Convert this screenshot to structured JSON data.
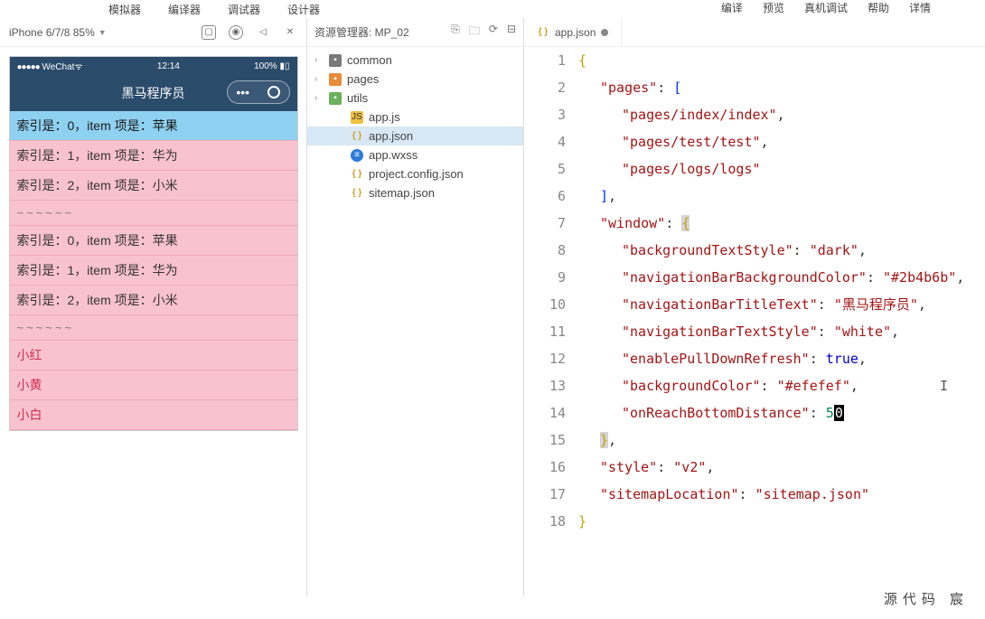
{
  "top_menu_left": [
    "模拟器",
    "编译器",
    "调试器",
    "设计器"
  ],
  "top_menu_right": [
    "编译",
    "预览",
    "真机调试",
    "帮助",
    "详情"
  ],
  "simulator": {
    "device_label": "iPhone 6/7/8 85%",
    "status": {
      "carrier": "WeChat",
      "dots": "●●●●●",
      "time": "12:14",
      "battery": "100%"
    },
    "nav_title": "黑马程序员",
    "rows": [
      {
        "type": "blue",
        "text": "索引是：0，item 项是：苹果"
      },
      {
        "type": "pink",
        "text": "索引是：1，item 项是：华为"
      },
      {
        "type": "pink",
        "text": "索引是：2，item 项是：小米"
      },
      {
        "type": "tilde",
        "text": "~~~~~~"
      },
      {
        "type": "pink",
        "text": "索引是：0，item 项是：苹果"
      },
      {
        "type": "pink",
        "text": "索引是：1，item 项是：华为"
      },
      {
        "type": "pink",
        "text": "索引是：2，item 项是：小米"
      },
      {
        "type": "tilde",
        "text": "~~~~~~"
      },
      {
        "type": "name",
        "text": "小红"
      },
      {
        "type": "name",
        "text": "小黄"
      },
      {
        "type": "name",
        "text": "小白"
      }
    ]
  },
  "explorer": {
    "title": "资源管理器: MP_02",
    "tree": [
      {
        "lvl": "root",
        "chev": "›",
        "icon": "folder",
        "label": "common"
      },
      {
        "lvl": "root",
        "chev": "›",
        "icon": "folder-o",
        "label": "pages"
      },
      {
        "lvl": "root",
        "chev": "›",
        "icon": "folder-g",
        "label": "utils"
      },
      {
        "lvl": "l2",
        "icon": "js",
        "label": "app.js"
      },
      {
        "lvl": "l2",
        "icon": "json",
        "label": "app.json",
        "active": true
      },
      {
        "lvl": "l2",
        "icon": "wxss",
        "label": "app.wxss"
      },
      {
        "lvl": "l2",
        "icon": "json",
        "label": "project.config.json"
      },
      {
        "lvl": "l2",
        "icon": "json",
        "label": "sitemap.json"
      }
    ]
  },
  "editor": {
    "tab_label": "app.json",
    "code": {
      "l1": "{",
      "l2_k": "\"pages\"",
      "l2_b": "[",
      "l3": "\"pages/index/index\"",
      "l4": "\"pages/test/test\"",
      "l5": "\"pages/logs/logs\"",
      "l6": "]",
      "l7_k": "\"window\"",
      "l8_k": "\"backgroundTextStyle\"",
      "l8_v": "\"dark\"",
      "l9_k": "\"navigationBarBackgroundColor\"",
      "l9_v": "\"#2b4b6b\"",
      "l10_k": "\"navigationBarTitleText\"",
      "l10_v": "\"黑马程序员\"",
      "l11_k": "\"navigationBarTextStyle\"",
      "l11_v": "\"white\"",
      "l12_k": "\"enablePullDownRefresh\"",
      "l12_v": "true",
      "l13_k": "\"backgroundColor\"",
      "l13_v": "\"#efefef\"",
      "l14_k": "\"onReachBottomDistance\"",
      "l14_v": "50",
      "l16_k": "\"style\"",
      "l16_v": "\"v2\"",
      "l17_k": "\"sitemapLocation\"",
      "l17_v": "\"sitemap.json\"",
      "l18": "}"
    }
  },
  "watermark": "源代码  宸"
}
